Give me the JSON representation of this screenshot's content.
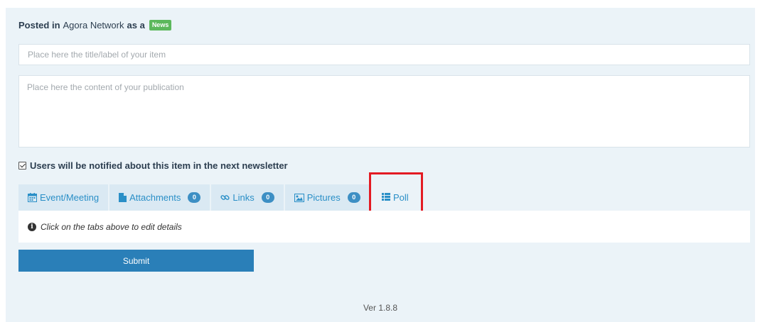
{
  "header": {
    "posted_in_label": "Posted in",
    "network_name": "Agora Network",
    "as_a_label": "as a",
    "type_badge": "News"
  },
  "form": {
    "title_placeholder": "Place here the title/label of your item",
    "title_value": "",
    "content_placeholder": "Place here the content of your publication",
    "content_value": "",
    "notify_checked": true,
    "notify_label": "Users will be notified about this item in the next newsletter"
  },
  "tabs": [
    {
      "label": "Event/Meeting",
      "icon": "calendar-icon"
    },
    {
      "label": "Attachments",
      "icon": "file-icon",
      "count": "0"
    },
    {
      "label": "Links",
      "icon": "link-icon",
      "count": "0"
    },
    {
      "label": "Pictures",
      "icon": "image-icon",
      "count": "0"
    },
    {
      "label": "Poll",
      "icon": "list-icon",
      "highlighted": true
    }
  ],
  "info": {
    "message": "Click on the tabs above to edit details"
  },
  "actions": {
    "submit_label": "Submit"
  },
  "footer": {
    "version": "Ver 1.8.8"
  },
  "colors": {
    "panel_bg": "#ebf3f8",
    "tab_bg": "#dae9f3",
    "link_blue": "#2a8fc7",
    "submit_blue": "#2a7fb8",
    "badge_green": "#5cb85c",
    "highlight_red": "#e31b23"
  }
}
